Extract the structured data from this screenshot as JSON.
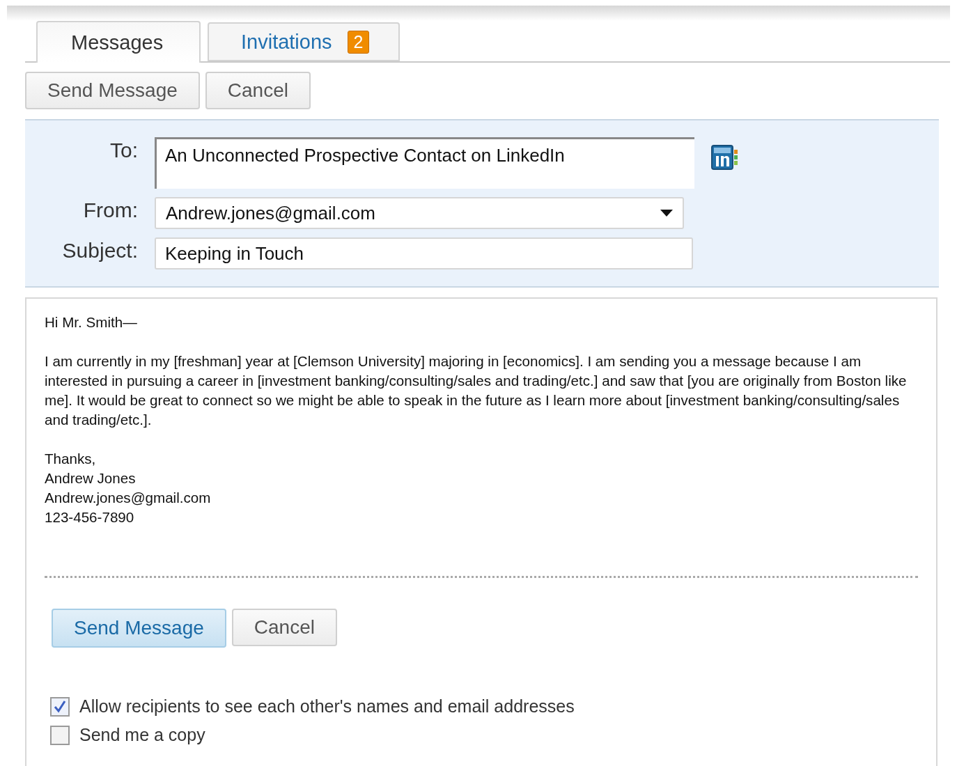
{
  "tabs": [
    {
      "label": "Messages",
      "selected": true
    },
    {
      "label": "Invitations",
      "selected": false,
      "badge": "2"
    }
  ],
  "top_actions": [
    {
      "label": "Send Message",
      "kind": "secondary"
    },
    {
      "label": "Cancel",
      "kind": "secondary"
    }
  ],
  "form": {
    "to": {
      "label": "To:",
      "value": "An Unconnected Prospective Contact on LinkedIn"
    },
    "from": {
      "label": "From:",
      "value": "Andrew.jones@gmail.com"
    },
    "subject": {
      "label": "Subject:",
      "value": "Keeping in Touch"
    }
  },
  "message": {
    "greeting": "Hi Mr. Smith—",
    "paragraph": "I am currently in my [freshman] year at [Clemson University] majoring in [economics]. I am sending you a message because I am interested in pursuing a career in [investment banking/consulting/sales and trading/etc.] and saw that [you are originally from Boston like me]. It would be great to connect so we might be able to speak in the future as I learn more about [investment banking/consulting/sales and trading/etc.].",
    "signature": [
      "Thanks,",
      "Andrew Jones",
      "Andrew.jones@gmail.com",
      "123-456-7890"
    ]
  },
  "bottom_actions": [
    {
      "label": "Send Message",
      "kind": "primary"
    },
    {
      "label": "Cancel",
      "kind": "secondary"
    }
  ],
  "options": [
    {
      "label": "Allow recipients to see each other's names and email addresses",
      "checked": true
    },
    {
      "label": "Send me a copy",
      "checked": false
    }
  ]
}
